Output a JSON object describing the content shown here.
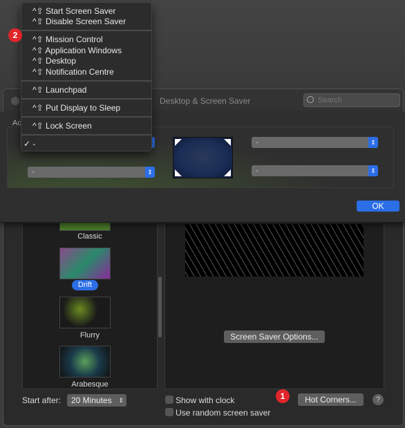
{
  "window": {
    "title": "Desktop & Screen Saver",
    "search_placeholder": "Search"
  },
  "hot_corners": {
    "active_label": "Ac",
    "top_left": "-",
    "top_right": "-",
    "bottom_left": "-",
    "bottom_right": "-",
    "ok_label": "OK"
  },
  "menu": {
    "shortcut_prefix": "^⇧",
    "groups": [
      [
        "Start Screen Saver",
        "Disable Screen Saver"
      ],
      [
        "Mission Control",
        "Application Windows",
        "Desktop",
        "Notification Centre"
      ],
      [
        "Launchpad"
      ],
      [
        "Put Display to Sleep"
      ],
      [
        "Lock Screen"
      ]
    ],
    "selected": "-",
    "checkmark": "✓"
  },
  "badges": {
    "one": "1",
    "two": "2",
    "color": "#e0262a"
  },
  "screen_savers": [
    {
      "name": "Classic"
    },
    {
      "name": "Drift",
      "selected": true
    },
    {
      "name": "Flurry"
    },
    {
      "name": "Arabesque"
    }
  ],
  "preview": {
    "options_button": "Screen Saver Options..."
  },
  "bottom": {
    "start_after_label": "Start after:",
    "start_after_value": "20 Minutes",
    "show_clock": "Show with clock",
    "show_clock_checked": false,
    "random": "Use random screen saver",
    "random_checked": false,
    "hot_corners_button": "Hot Corners...",
    "help": "?"
  },
  "colors": {
    "accent": "#2b6ee6"
  }
}
